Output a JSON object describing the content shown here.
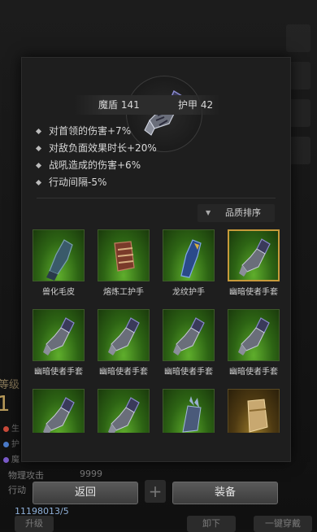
{
  "background": {
    "level_label": "等级",
    "level_value": "1",
    "stats": [
      {
        "label": "生",
        "color": "#c94a3a"
      },
      {
        "label": "护",
        "color": "#4a7ac9"
      },
      {
        "label": "魔",
        "color": "#7a5ac9"
      }
    ],
    "attack_label": "物理攻击",
    "attack_value": "9999",
    "action_label": "行动",
    "gems": "11198013/5",
    "bottom_buttons": [
      "升级",
      "卸下",
      "一键穿戴"
    ]
  },
  "item": {
    "stats": [
      {
        "label": "魔盾",
        "value": "141"
      },
      {
        "label": "护甲",
        "value": "42"
      }
    ],
    "stat_text_1": "魔盾 141",
    "stat_text_2": "护甲 42",
    "effects": [
      "对首领的伤害+7%",
      "对敌负面效果时长+20%",
      "战吼造成的伤害+6%",
      "行动间隔-5%"
    ]
  },
  "sort": {
    "label": "品质排序",
    "arrow": "▼"
  },
  "inventory": [
    {
      "name": "兽化毛皮",
      "icon": "fur-glove-icon",
      "style": "green"
    },
    {
      "name": "熔炼工护手",
      "icon": "forge-gauntlet-icon",
      "style": "green"
    },
    {
      "name": "龙纹护手",
      "icon": "dragon-gauntlet-icon",
      "style": "green"
    },
    {
      "name": "幽暗使者手套",
      "icon": "shadow-gauntlet-icon",
      "style": "green",
      "selected": true
    },
    {
      "name": "幽暗使者手套",
      "icon": "shadow-gauntlet-icon",
      "style": "green"
    },
    {
      "name": "幽暗使者手套",
      "icon": "shadow-gauntlet-icon",
      "style": "green"
    },
    {
      "name": "幽暗使者手套",
      "icon": "shadow-gauntlet-icon",
      "style": "green"
    },
    {
      "name": "幽暗使者手套",
      "icon": "shadow-gauntlet-icon",
      "style": "green"
    },
    {
      "name": "",
      "icon": "shadow-gauntlet-icon",
      "style": "green"
    },
    {
      "name": "",
      "icon": "shadow-gauntlet-icon",
      "style": "green"
    },
    {
      "name": "",
      "icon": "crystal-gauntlet-icon",
      "style": "green"
    },
    {
      "name": "",
      "icon": "golden-gauntlet-icon",
      "style": "gold"
    }
  ],
  "buttons": {
    "back": "返回",
    "equip": "装备",
    "plus": "+"
  }
}
